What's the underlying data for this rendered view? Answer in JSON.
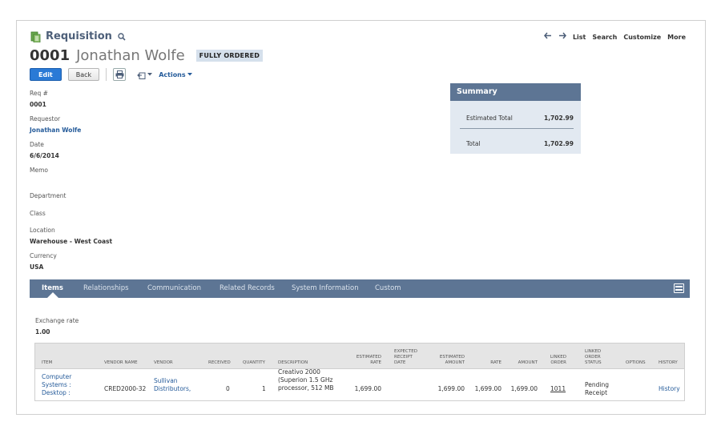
{
  "header": {
    "record_type": "Requisition",
    "record_number": "0001",
    "record_name": "Jonathan Wolfe",
    "status": "FULLY ORDERED"
  },
  "nav": {
    "list": "List",
    "search": "Search",
    "customize": "Customize",
    "more": "More"
  },
  "toolbar": {
    "edit": "Edit",
    "back": "Back",
    "actions": "Actions"
  },
  "fields": {
    "req_label": "Req #",
    "req_value": "0001",
    "requestor_label": "Requestor",
    "requestor_value": "Jonathan Wolfe",
    "date_label": "Date",
    "date_value": "6/6/2014",
    "memo_label": "Memo",
    "department_label": "Department",
    "class_label": "Class",
    "location_label": "Location",
    "location_value": "Warehouse - West Coast",
    "currency_label": "Currency",
    "currency_value": "USA"
  },
  "summary": {
    "title": "Summary",
    "estimated_total_label": "Estimated Total",
    "estimated_total_value": "1,702.99",
    "total_label": "Total",
    "total_value": "1,702.99"
  },
  "tabs": [
    {
      "label": "Items",
      "active": true
    },
    {
      "label": "Relationships",
      "active": false
    },
    {
      "label": "Communication",
      "active": false
    },
    {
      "label": "Related Records",
      "active": false
    },
    {
      "label": "System Information",
      "active": false
    },
    {
      "label": "Custom",
      "active": false
    }
  ],
  "exchange": {
    "label": "Exchange rate",
    "value": "1.00"
  },
  "items_table": {
    "columns": {
      "item": "ITEM",
      "vendor_name": "VENDOR NAME",
      "vendor": "VENDOR",
      "received": "RECEIVED",
      "quantity": "QUANTITY",
      "description": "DESCRIPTION",
      "est_rate_1": "ESTIMATED",
      "est_rate_2": "RATE",
      "exp_1": "EXPECTED",
      "exp_2": "RECEIPT",
      "exp_3": "DATE",
      "est_amount_1": "ESTIMATED",
      "est_amount_2": "AMOUNT",
      "rate": "RATE",
      "amount": "AMOUNT",
      "linked_order_1": "LINKED",
      "linked_order_2": "ORDER",
      "los_1": "LINKED",
      "los_2": "ORDER",
      "los_3": "STATUS",
      "options": "OPTIONS",
      "history": "HISTORY"
    },
    "row": {
      "item_1": "Computer",
      "item_2": "Systems :",
      "item_3": "Desktop :",
      "vendor_name": "CRED2000-32",
      "vendor_1": "Sullivan",
      "vendor_2": "Distributors,",
      "received": "0",
      "quantity": "1",
      "desc_1": "Creativo 2000",
      "desc_2": "(Superion 1.5 GHz",
      "desc_3": "processor, 512 MB",
      "est_rate": "1,699.00",
      "est_amount": "1,699.00",
      "rate": "1,699.00",
      "amount": "1,699.00",
      "linked_order": "1011",
      "status_1": "Pending",
      "status_2": "Receipt",
      "history": "History"
    }
  },
  "colors": {
    "accent": "#2a7ad6",
    "bar": "#5d7594",
    "link": "#255b9a",
    "summary_bg": "#e2e9f1"
  },
  "icons": {
    "record": "requisition-doc-icon",
    "search": "search-icon",
    "back_nav": "arrow-left-icon",
    "fwd_nav": "arrow-right-icon",
    "print": "print-icon",
    "export": "export-icon",
    "tools": "tab-tools-icon"
  }
}
